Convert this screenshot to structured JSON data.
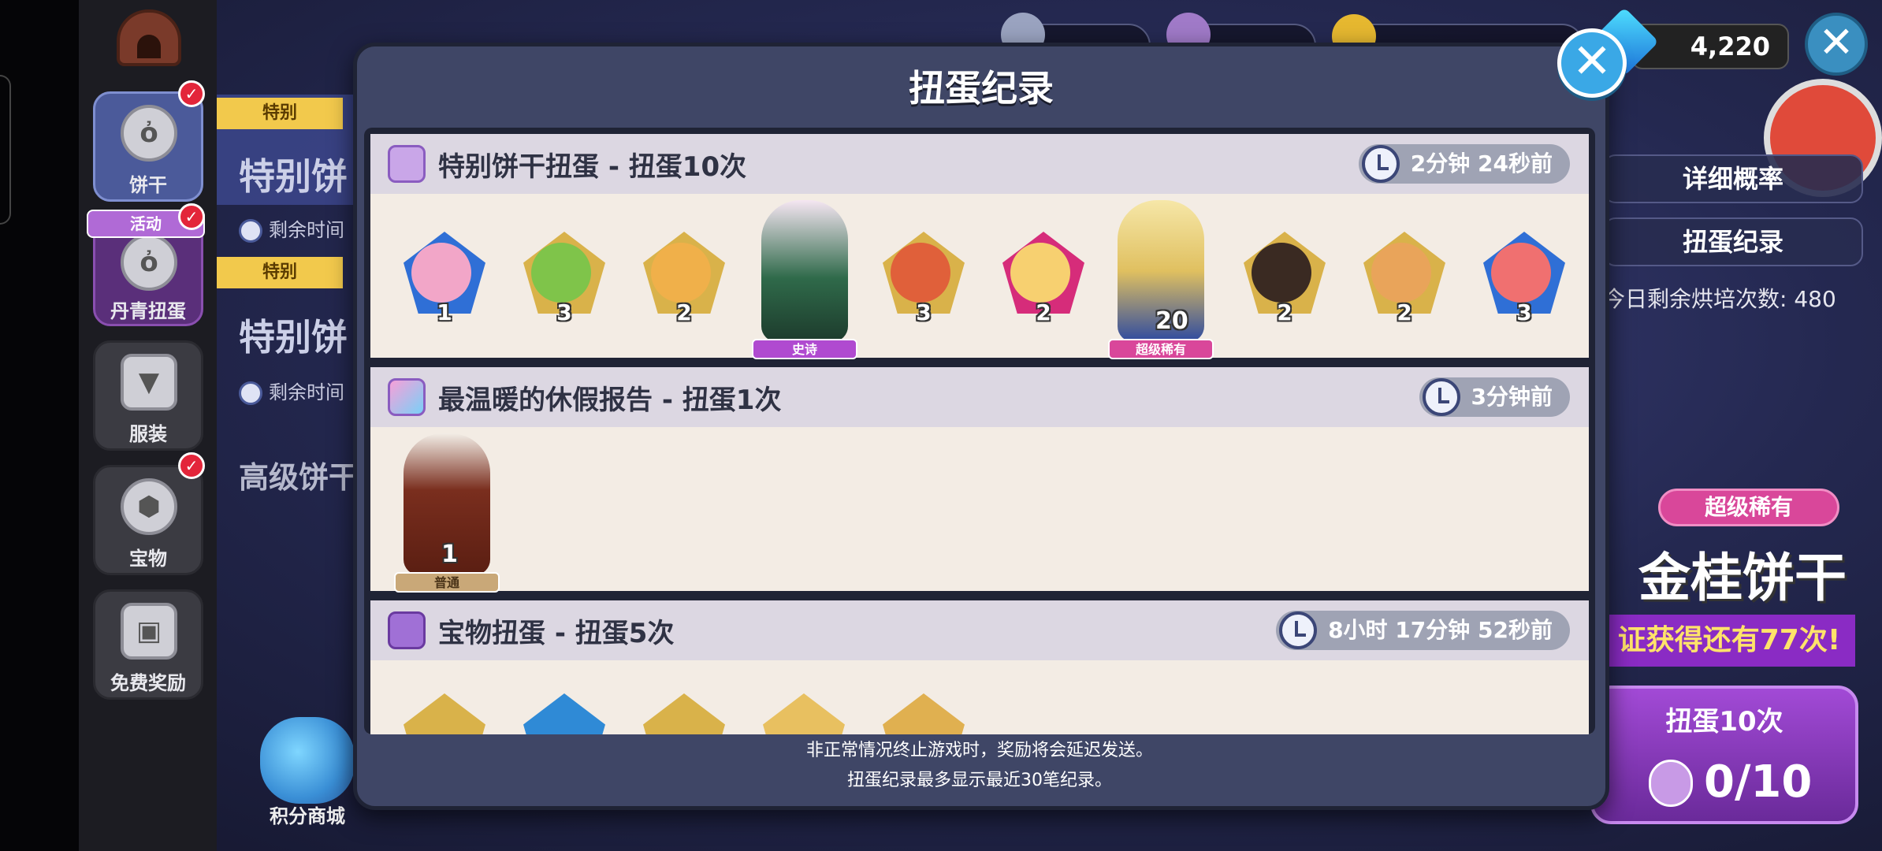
{
  "sidebar": {
    "items": [
      {
        "label": "饼干",
        "icon": "cookie-face-icon",
        "badge": "✓"
      },
      {
        "label": "丹青扭蛋",
        "icon": "gacha-icon",
        "badge": "✓",
        "tag": "活动"
      },
      {
        "label": "服装",
        "icon": "shirt-icon"
      },
      {
        "label": "宝物",
        "icon": "treasure-icon",
        "badge": "✓"
      },
      {
        "label": "免费奖励",
        "icon": "gift-icon"
      }
    ],
    "shop_label": "积分商城"
  },
  "background": {
    "banners": [
      {
        "tag": "特别",
        "title": "特别饼",
        "timer": "剩余时间"
      },
      {
        "tag": "特别",
        "title": "特别饼",
        "timer": "剩余时间"
      }
    ],
    "advanced_label": "高级饼干",
    "gem_count": "4,220",
    "right_buttons": [
      "详细概率",
      "扭蛋纪录"
    ],
    "daily_remaining": "今日剩余烘培次数: 480",
    "rarity_badge": "超级稀有",
    "featured_cookie": "金桂饼干",
    "guarantee": "证获得还有77次!",
    "pull10": {
      "label": "扭蛋10次",
      "count": "0/10"
    }
  },
  "modal": {
    "title": "扭蛋纪录",
    "close": "✕",
    "records": [
      {
        "title": "特别饼干扭蛋 - 扭蛋10次",
        "time": "2分钟 24秒前",
        "items": [
          {
            "type": "gem",
            "count": "1"
          },
          {
            "type": "gem",
            "count": "3"
          },
          {
            "type": "gem",
            "count": "2"
          },
          {
            "type": "figure",
            "label": "史诗"
          },
          {
            "type": "gem",
            "count": "3"
          },
          {
            "type": "gem",
            "count": "2"
          },
          {
            "type": "figure",
            "label": "超级稀有",
            "count": "20"
          },
          {
            "type": "gem",
            "count": "2"
          },
          {
            "type": "gem",
            "count": "2"
          },
          {
            "type": "gem",
            "count": "3"
          }
        ]
      },
      {
        "title": "最温暖的休假报告 - 扭蛋1次",
        "time": "3分钟前",
        "items": [
          {
            "type": "figure",
            "label": "普通",
            "count": "1"
          }
        ]
      },
      {
        "title": "宝物扭蛋 - 扭蛋5次",
        "time": "8小时 17分钟 52秒前",
        "items": []
      }
    ],
    "footer": [
      "非正常情况终止游戏时，奖励将会延迟发送。",
      "扭蛋纪录最多显示最近30笔纪录。"
    ]
  },
  "colors": {
    "modal_bg": "#3f4666",
    "record_bg": "#f3ece4",
    "record_header": "#dcd7e2",
    "close_button": "#3aa8e6",
    "accent_purple": "#8a2bc4"
  }
}
